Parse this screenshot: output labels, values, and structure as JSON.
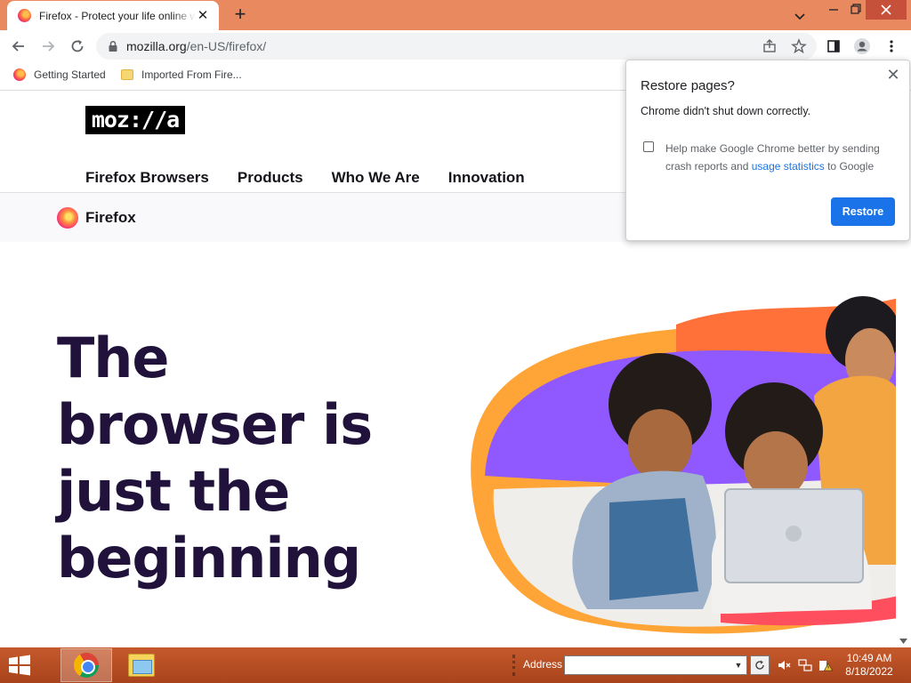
{
  "browser": {
    "tab_title": "Firefox - Protect your life online with privacy-first products",
    "url_host": "mozilla.org",
    "url_path": "/en-US/firefox/"
  },
  "bookmarks": [
    {
      "label": "Getting Started",
      "icon": "firefox-icon"
    },
    {
      "label": "Imported From Fire...",
      "icon": "folder-icon"
    }
  ],
  "site": {
    "logo": "moz://a",
    "nav": [
      "Firefox Browsers",
      "Products",
      "Who We Are",
      "Innovation"
    ],
    "product_name": "Firefox",
    "headline": [
      "The",
      "browser is",
      "just the",
      "beginning"
    ]
  },
  "dialog": {
    "title": "Restore pages?",
    "message": "Chrome didn't shut down correctly.",
    "checkbox_text_before": "Help make Google Chrome better by sending crash reports and ",
    "checkbox_link": "usage statistics",
    "checkbox_text_after": " to Google",
    "checked": false,
    "button": "Restore"
  },
  "taskbar": {
    "address_label": "Address",
    "address_value": "",
    "time": "10:49 AM",
    "date": "8/18/2022"
  },
  "colors": {
    "tab_strip": "#e8895f",
    "accent_blue": "#1a73e8",
    "headline": "#20123a",
    "taskbar": "#b34a20"
  }
}
